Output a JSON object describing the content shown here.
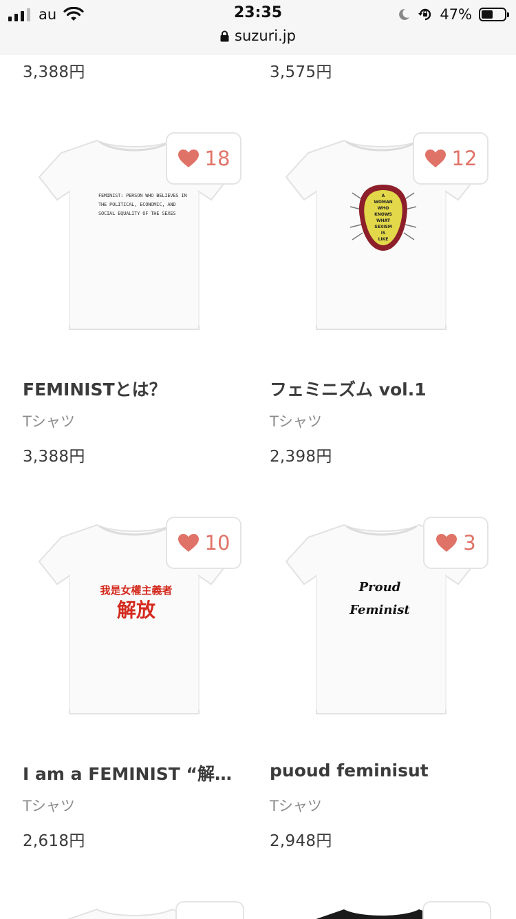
{
  "status_bar": {
    "carrier": "au",
    "time": "23:35",
    "url": "suzuri.jp",
    "battery": "47%"
  },
  "top_prices": [
    "3,388円",
    "3,575円"
  ],
  "products": [
    {
      "name": "FEMINISTとは？",
      "category": "Tシャツ",
      "price": "3,388円",
      "likes": "18",
      "print_lines": [
        "FEMINIST: PERSON WHO BELIEVES IN",
        "THE POLITICAL, ECONOMIC, AND",
        "SOCIAL EQUALITY OF THE SEXES"
      ]
    },
    {
      "name": "フェミニズム vol.1",
      "category": "Tシャツ",
      "price": "2,398円",
      "likes": "12",
      "print_lines": [
        "A",
        "WOMAN",
        "WHO",
        "KNOWS",
        "WHAT",
        "SEXISM",
        "IS",
        "LIKE"
      ]
    },
    {
      "name": "I am a FEMINIST “解…",
      "category": "Tシャツ",
      "price": "2,618円",
      "likes": "10",
      "print_lines": [
        "我是女權主義者",
        "解放"
      ]
    },
    {
      "name": "puoud feminisut",
      "category": "Tシャツ",
      "price": "2,948円",
      "likes": "3",
      "print_lines": [
        "Proud",
        "Feminist"
      ]
    }
  ],
  "colors": {
    "accent": "#e07368",
    "text": "#3b3b3b",
    "muted": "#8c8c8c"
  }
}
